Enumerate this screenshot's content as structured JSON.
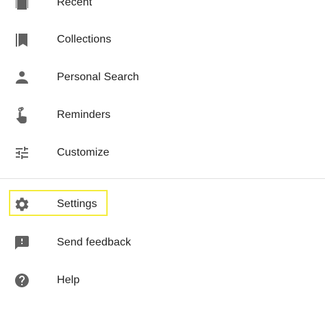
{
  "menu": {
    "items": [
      {
        "label": "Recent",
        "icon": "recent-icon"
      },
      {
        "label": "Collections",
        "icon": "bookmark-icon"
      },
      {
        "label": "Personal Search",
        "icon": "person-icon"
      },
      {
        "label": "Reminders",
        "icon": "reminder-hand-icon"
      },
      {
        "label": "Customize",
        "icon": "tune-icon"
      },
      {
        "label": "Settings",
        "icon": "gear-icon"
      },
      {
        "label": "Send feedback",
        "icon": "feedback-icon"
      },
      {
        "label": "Help",
        "icon": "help-icon"
      }
    ]
  },
  "colors": {
    "icon": "#616161",
    "text": "#212121",
    "divider": "#e0e0e0",
    "highlight": "#f4ec3c"
  }
}
